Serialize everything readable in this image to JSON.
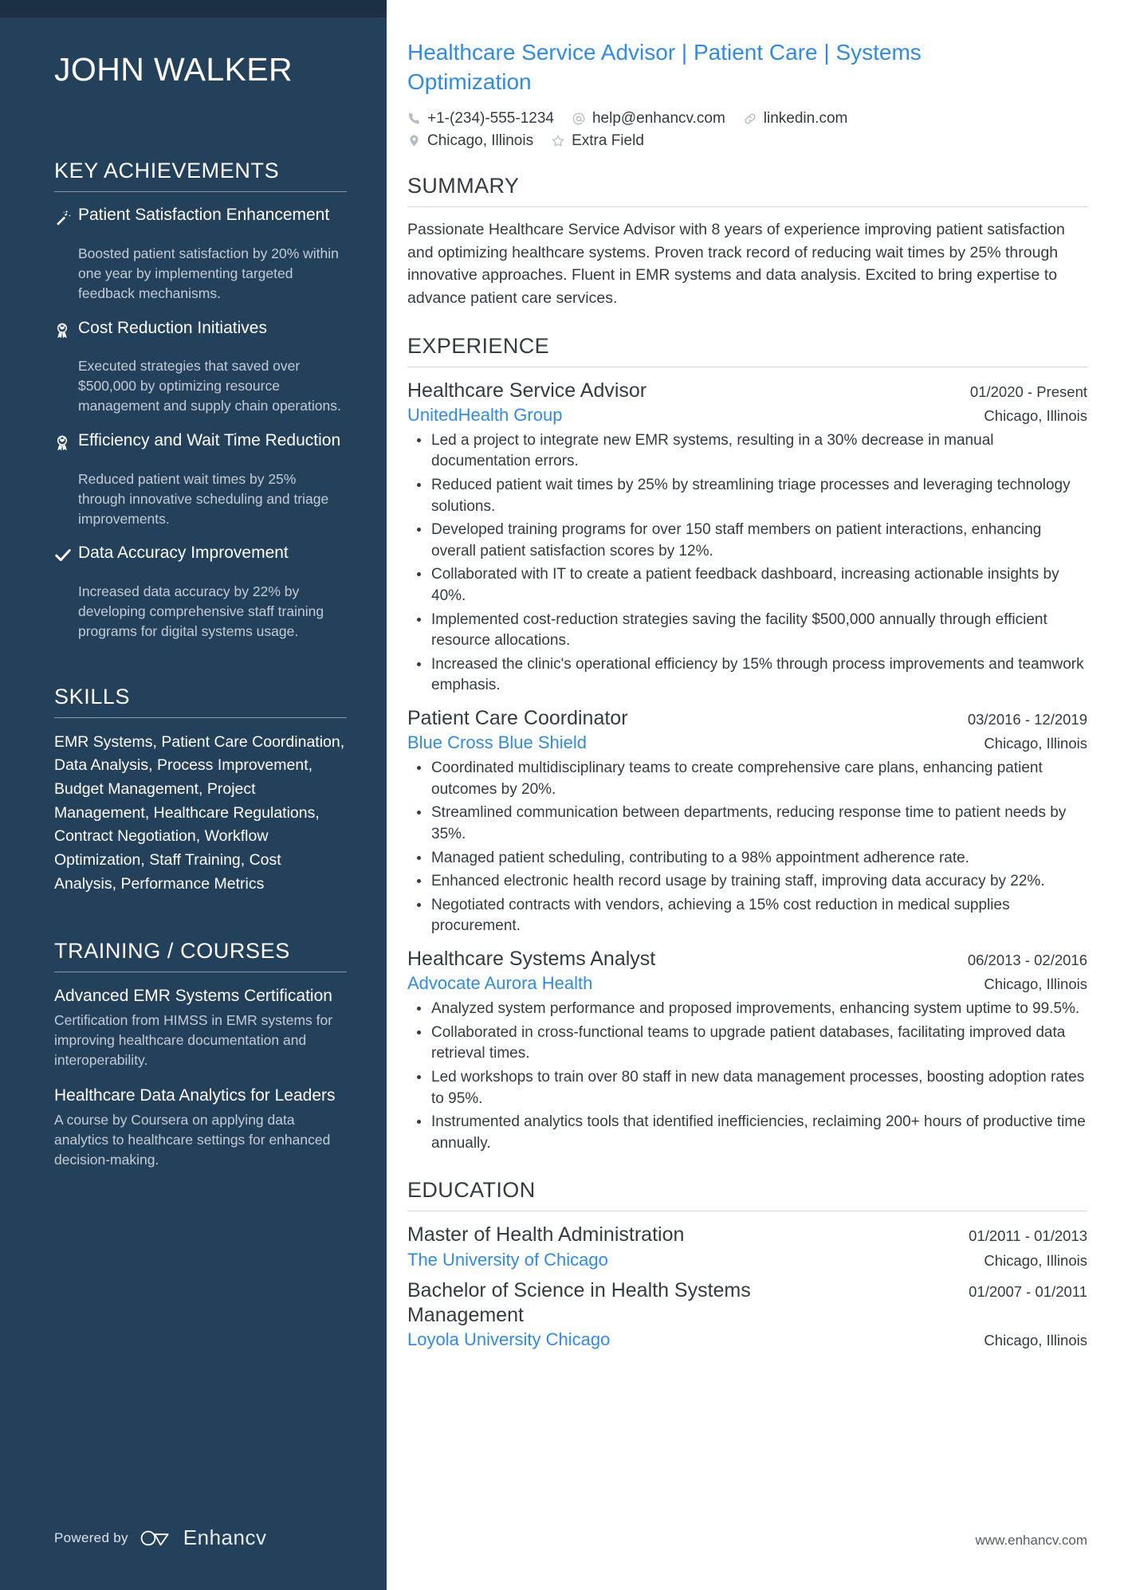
{
  "candidate": {
    "name": "JOHN WALKER",
    "headline": "Healthcare Service Advisor | Patient Care | Systems Optimization"
  },
  "contact": {
    "phone": "+1-(234)-555-1234",
    "email": "help@enhancv.com",
    "linkedin": "linkedin.com",
    "location": "Chicago, Illinois",
    "extra": "Extra Field"
  },
  "sidebar": {
    "achievements_title": "KEY ACHIEVEMENTS",
    "achievements": [
      {
        "icon": "magic-wand-icon",
        "title": "Patient Satisfaction Enhancement",
        "desc": "Boosted patient satisfaction by 20% within one year by implementing targeted feedback mechanisms."
      },
      {
        "icon": "award-ribbon-icon",
        "title": "Cost Reduction Initiatives",
        "desc": "Executed strategies that saved over $500,000 by optimizing resource management and supply chain operations."
      },
      {
        "icon": "award-ribbon-icon",
        "title": "Efficiency and Wait Time Reduction",
        "desc": "Reduced patient wait times by 25% through innovative scheduling and triage improvements."
      },
      {
        "icon": "check-icon",
        "title": "Data Accuracy Improvement",
        "desc": "Increased data accuracy by 22% by developing comprehensive staff training programs for digital systems usage."
      }
    ],
    "skills_title": "SKILLS",
    "skills_text": "EMR Systems, Patient Care Coordination, Data Analysis, Process Improvement, Budget Management, Project Management, Healthcare Regulations, Contract Negotiation, Workflow Optimization, Staff Training, Cost Analysis, Performance Metrics",
    "training_title": "TRAINING / COURSES",
    "courses": [
      {
        "title": "Advanced EMR Systems Certification",
        "desc": "Certification from HIMSS in EMR systems for improving healthcare documentation and interoperability."
      },
      {
        "title": "Healthcare Data Analytics for Leaders",
        "desc": "A course by Coursera on applying data analytics to healthcare settings for enhanced decision-making."
      }
    ],
    "powered_by_label": "Powered by",
    "brand": "Enhancv"
  },
  "main": {
    "summary_title": "SUMMARY",
    "summary_text": "Passionate Healthcare Service Advisor with 8 years of experience improving patient satisfaction and optimizing healthcare systems. Proven track record of reducing wait times by 25% through innovative approaches. Fluent in EMR systems and data analysis. Excited to bring expertise to advance patient care services.",
    "experience_title": "EXPERIENCE",
    "experience": [
      {
        "title": "Healthcare Service Advisor",
        "date": "01/2020 - Present",
        "org": "UnitedHealth Group",
        "location": "Chicago, Illinois",
        "bullets": [
          "Led a project to integrate new EMR systems, resulting in a 30% decrease in manual documentation errors.",
          "Reduced patient wait times by 25% by streamlining triage processes and leveraging technology solutions.",
          "Developed training programs for over 150 staff members on patient interactions, enhancing overall patient satisfaction scores by 12%.",
          "Collaborated with IT to create a patient feedback dashboard, increasing actionable insights by 40%.",
          "Implemented cost-reduction strategies saving the facility $500,000 annually through efficient resource allocations.",
          "Increased the clinic's operational efficiency by 15% through process improvements and teamwork emphasis."
        ]
      },
      {
        "title": "Patient Care Coordinator",
        "date": "03/2016 - 12/2019",
        "org": "Blue Cross Blue Shield",
        "location": "Chicago, Illinois",
        "bullets": [
          "Coordinated multidisciplinary teams to create comprehensive care plans, enhancing patient outcomes by 20%.",
          "Streamlined communication between departments, reducing response time to patient needs by 35%.",
          "Managed patient scheduling, contributing to a 98% appointment adherence rate.",
          "Enhanced electronic health record usage by training staff, improving data accuracy by 22%.",
          "Negotiated contracts with vendors, achieving a 15% cost reduction in medical supplies procurement."
        ]
      },
      {
        "title": "Healthcare Systems Analyst",
        "date": "06/2013 - 02/2016",
        "org": "Advocate Aurora Health",
        "location": "Chicago, Illinois",
        "bullets": [
          "Analyzed system performance and proposed improvements, enhancing system uptime to 99.5%.",
          "Collaborated in cross-functional teams to upgrade patient databases, facilitating improved data retrieval times.",
          "Led workshops to train over 80 staff in new data management processes, boosting adoption rates to 95%.",
          "Instrumented analytics tools that identified inefficiencies, reclaiming 200+ hours of productive time annually."
        ]
      }
    ],
    "education_title": "EDUCATION",
    "education": [
      {
        "degree": "Master of Health Administration",
        "date": "01/2011 - 01/2013",
        "school": "The University of Chicago",
        "location": "Chicago, Illinois"
      },
      {
        "degree": "Bachelor of Science in Health Systems Management",
        "date": "01/2007 - 01/2011",
        "school": "Loyola University Chicago",
        "location": "Chicago, Illinois"
      }
    ],
    "footer_url": "www.enhancv.com"
  },
  "colors": {
    "sidebar_bg": "#24415c",
    "accent_blue": "#2b8cf0",
    "body_text": "#333b43"
  }
}
